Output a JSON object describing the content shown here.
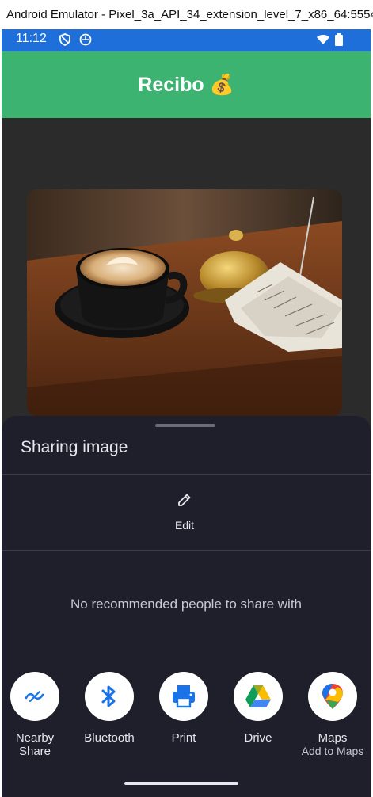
{
  "window": {
    "title": "Android Emulator - Pixel_3a_API_34_extension_level_7_x86_64:5554"
  },
  "status_bar": {
    "time": "11:12",
    "icons": [
      "shield-icon",
      "circle-app-icon",
      "wifi-icon",
      "battery-icon"
    ],
    "color": "#1e6fd9"
  },
  "app_bar": {
    "title": "Recibo 💰",
    "color": "#3cb371"
  },
  "share_sheet": {
    "title": "Sharing image",
    "edit_label": "Edit",
    "no_recommendations": "No recommended people to share with",
    "targets": [
      {
        "label": "Nearby\nShare",
        "icon": "nearby-share-icon"
      },
      {
        "label": "Bluetooth",
        "icon": "bluetooth-icon"
      },
      {
        "label": "Print",
        "icon": "printer-icon"
      },
      {
        "label": "Drive",
        "icon": "google-drive-icon"
      },
      {
        "label": "Maps",
        "sublabel": "Add to Maps",
        "icon": "google-maps-icon"
      }
    ]
  }
}
